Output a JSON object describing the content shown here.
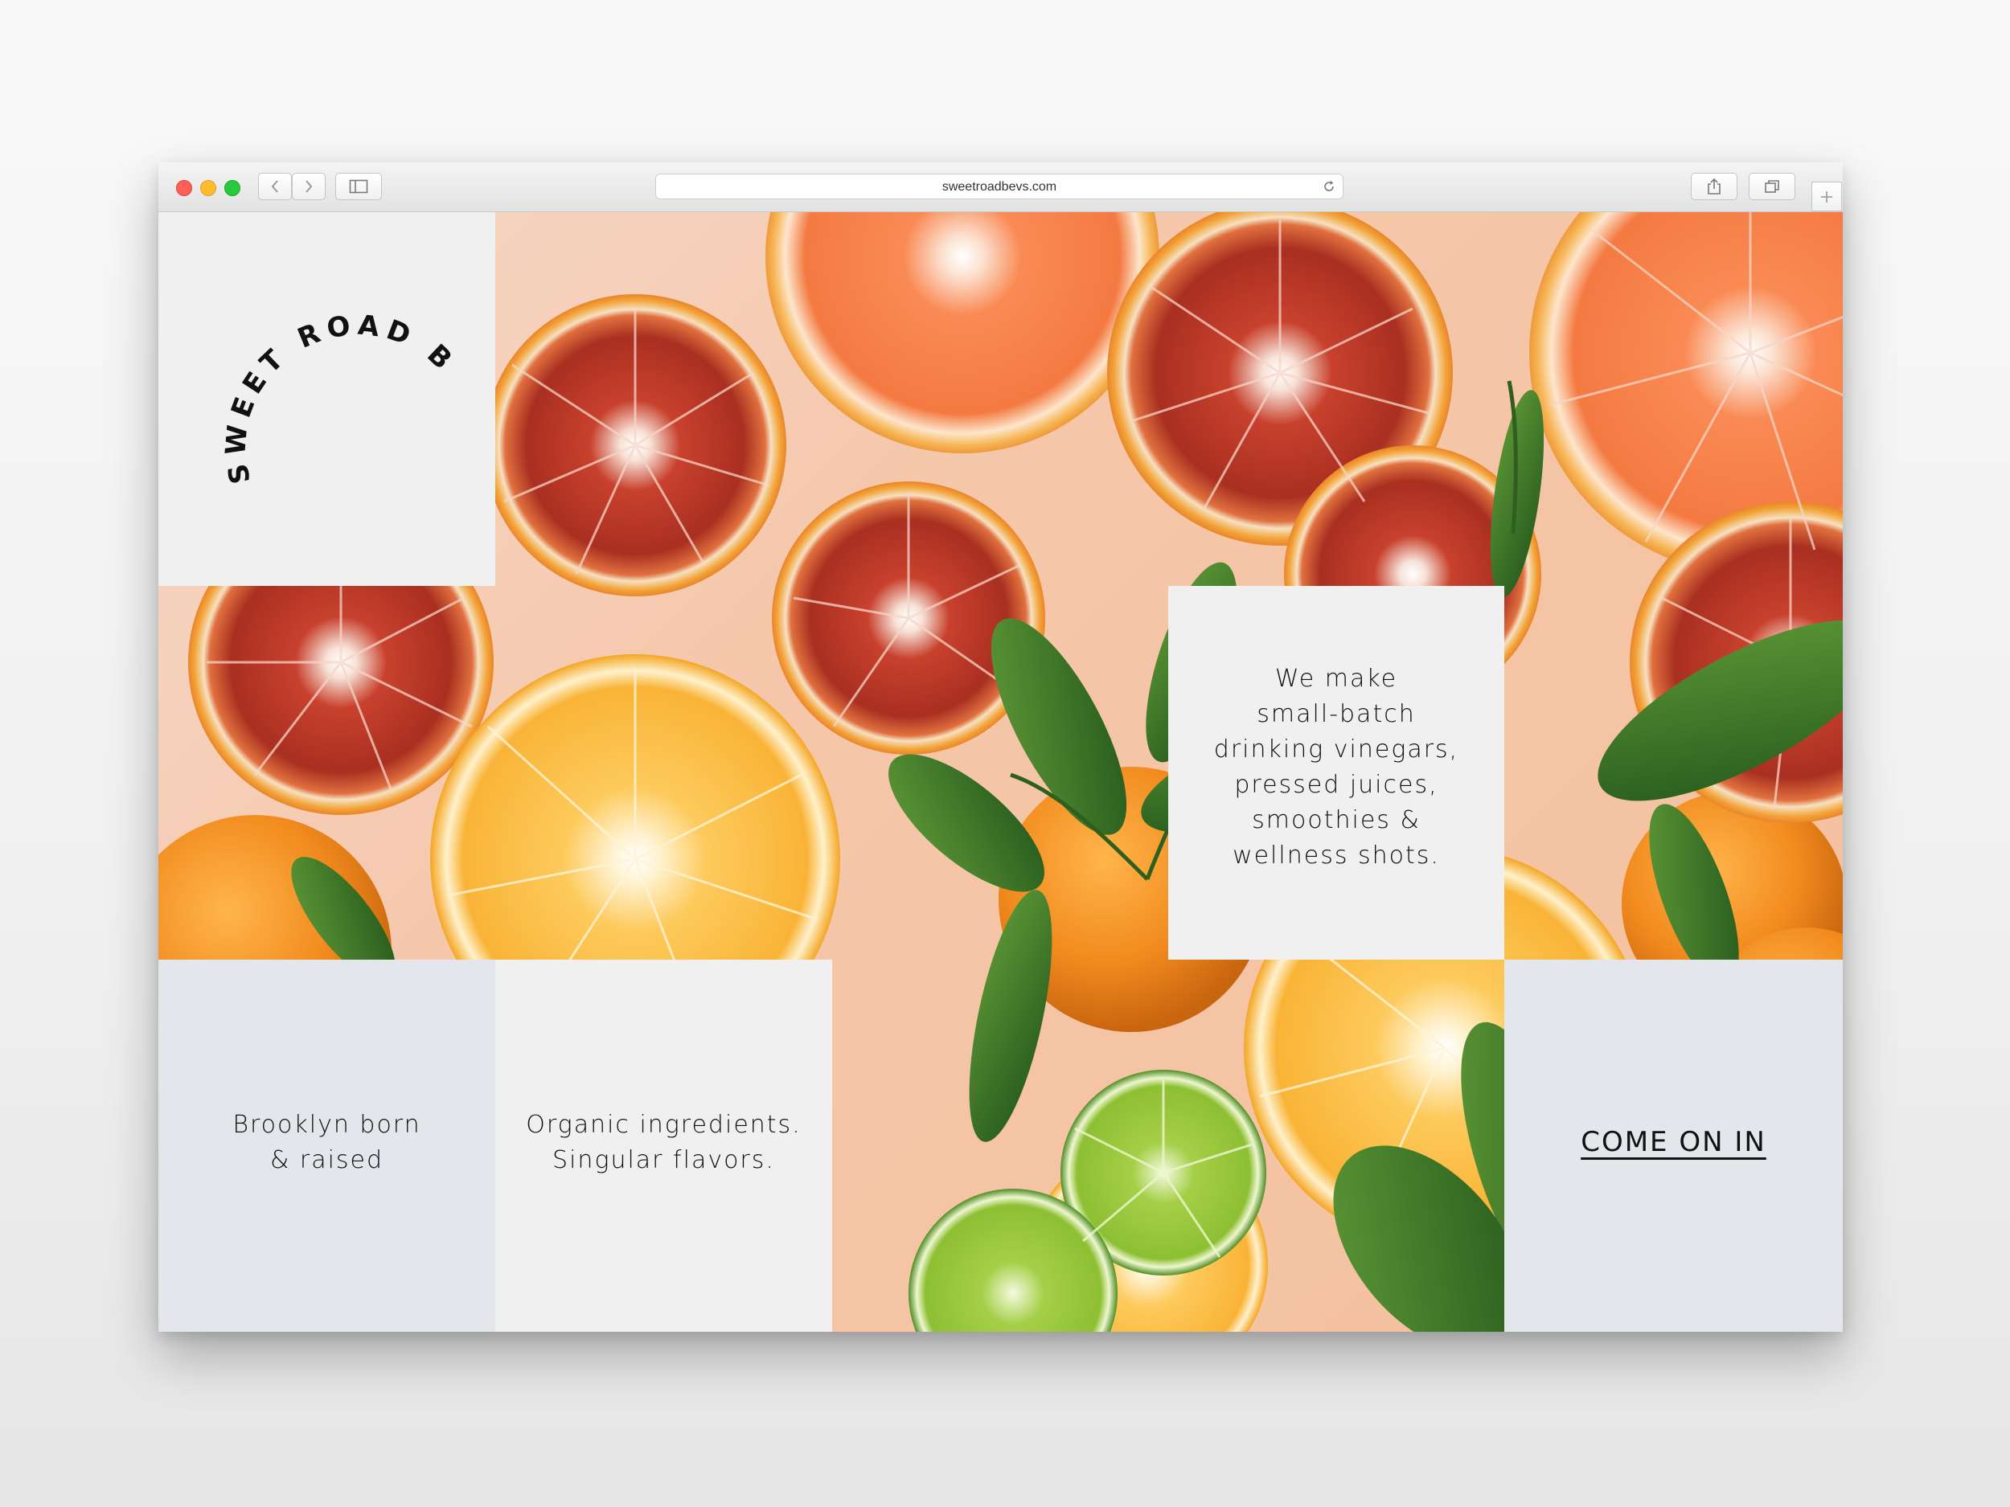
{
  "browser": {
    "url": "sweetroadbevs.com"
  },
  "brand": {
    "logo_text": "SWEET ROAD BEVS"
  },
  "panels": {
    "tagline": [
      "We make",
      "small-batch",
      "drinking vinegars,",
      "pressed juices,",
      "smoothies &",
      "wellness shots."
    ],
    "origin": [
      "Brooklyn born",
      "& raised"
    ],
    "ingredients": [
      "Organic ingredients.",
      "Singular flavors."
    ],
    "cta_label": "COME ON IN"
  },
  "colors": {
    "panel_light": "#f0f0f0",
    "panel_blue": "#e3e6ea",
    "text": "#111111"
  }
}
